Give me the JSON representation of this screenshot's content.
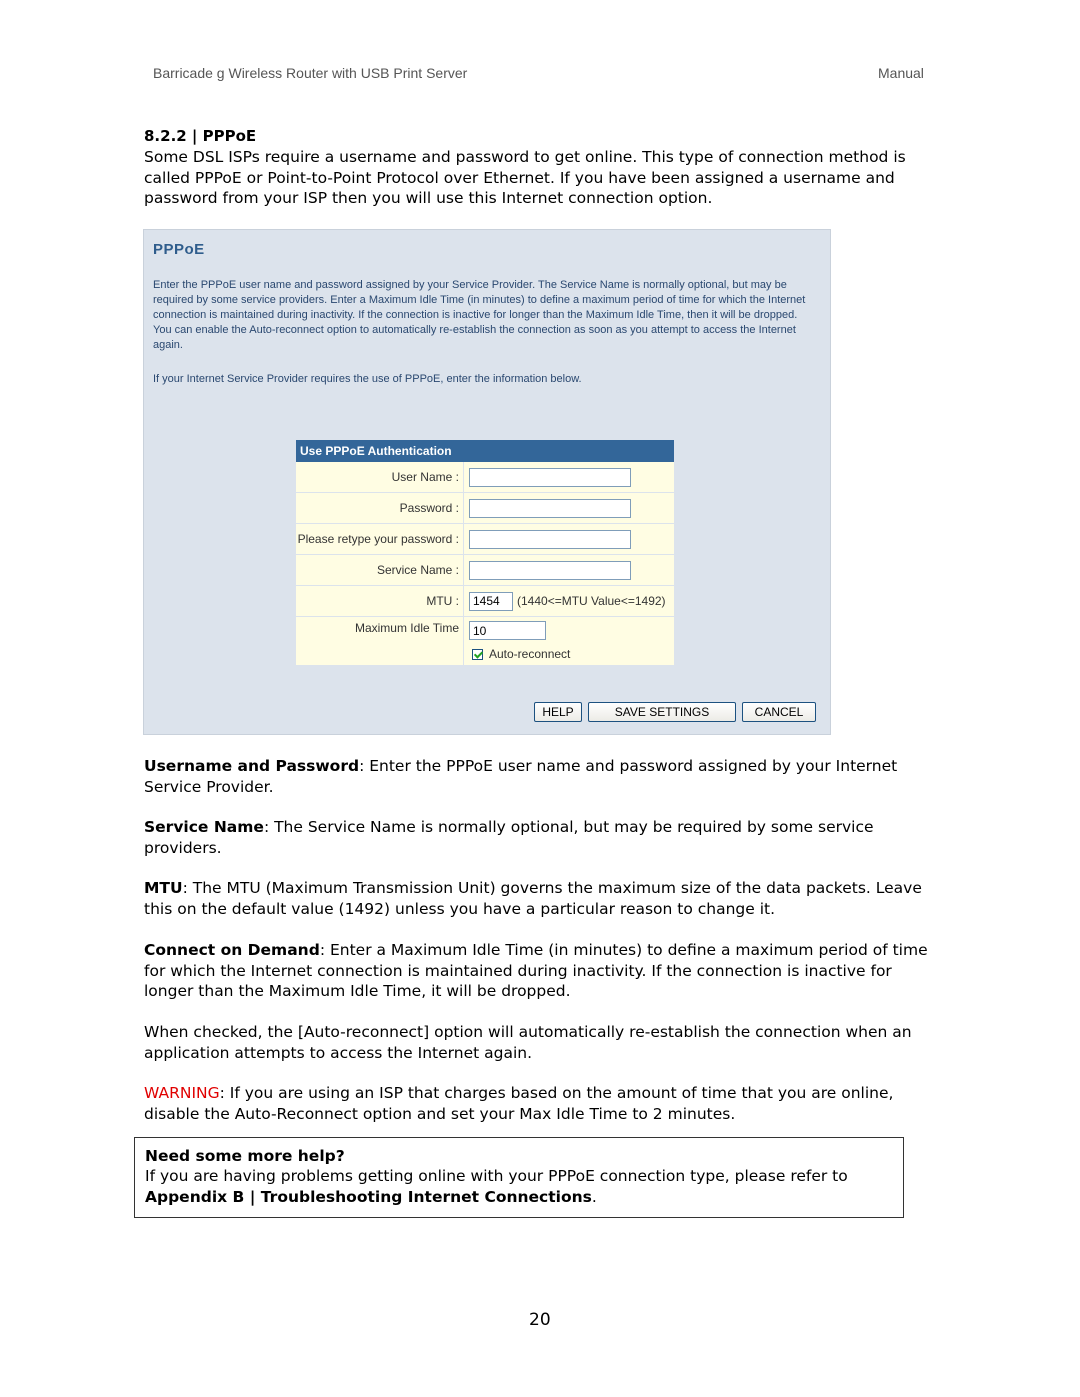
{
  "header": {
    "title": "Barricade g Wireless Router with USB Print Server",
    "doc_type": "Manual"
  },
  "section": {
    "title": "8.2.2 | PPPoE",
    "intro": "Some DSL ISPs require a username and password to get online.  This type of connection method is called PPPoE or Point-to-Point Protocol over Ethernet. If you have been assigned a username and password from your ISP then you will use this Internet connection option."
  },
  "screenshot": {
    "title": "PPPoE",
    "description": "Enter the PPPoE user name and password assigned by your Service Provider. The Service Name is normally optional, but may be required by some service providers.  Enter a Maximum Idle Time (in minutes) to define a maximum period of time for which the Internet connection is maintained during inactivity.  If the connection is inactive for longer than the Maximum Idle Time, then it will be dropped.  You can enable the Auto-reconnect option to automatically re-establish the connection as soon as you attempt to access the Internet again.",
    "note": "If your Internet Service Provider requires the use of PPPoE, enter the information below.",
    "form": {
      "heading": "Use PPPoE Authentication",
      "user_name_label": "User Name :",
      "user_name_value": "",
      "password_label": "Password :",
      "password_value": "",
      "retype_label": "Please retype your password :",
      "retype_value": "",
      "service_name_label": "Service Name :",
      "service_name_value": "",
      "mtu_label": "MTU :",
      "mtu_value": "1454",
      "mtu_hint": "(1440<=MTU Value<=1492)",
      "idle_label": "Maximum Idle Time",
      "idle_value": "10",
      "auto_reconnect_label": "Auto-reconnect",
      "auto_reconnect_checked": true
    },
    "buttons": {
      "help": "HELP",
      "save": "SAVE SETTINGS",
      "cancel": "CANCEL"
    }
  },
  "descriptions": [
    {
      "term": "Username and Password",
      "text": ": Enter the PPPoE user name and password assigned by your Internet Service Provider."
    },
    {
      "term": "Service Name",
      "text": ": The Service Name is normally optional, but may be required by some service providers."
    },
    {
      "term": "MTU",
      "text": ": The MTU (Maximum Transmission Unit) governs the maximum size of the data packets. Leave this on the default value (1492) unless you have a particular reason to change it."
    },
    {
      "term": "Connect on Demand",
      "text": ": Enter a Maximum Idle Time (in minutes) to define a maximum period of time for which the Internet connection is maintained during inactivity. If the connection is inactive for longer than the Maximum Idle Time, it will be dropped."
    }
  ],
  "auto_reconnect_para": "When checked, the [Auto-reconnect] option will automatically re-establish the connection when an application attempts to access the Internet again.",
  "warning": {
    "label": "WARNING",
    "text": ": If you are using an ISP that charges based on the amount of time that you are online, disable the Auto-Reconnect option and set your Max Idle Time to 2 minutes.",
    "color": "#e00000"
  },
  "help_box": {
    "title": "Need some more help?",
    "text": "If you are having problems getting online with your PPPoE connection type, please refer to",
    "link": "Appendix B | Troubleshooting Internet Connections",
    "link_suffix": "."
  },
  "page_number": "20"
}
